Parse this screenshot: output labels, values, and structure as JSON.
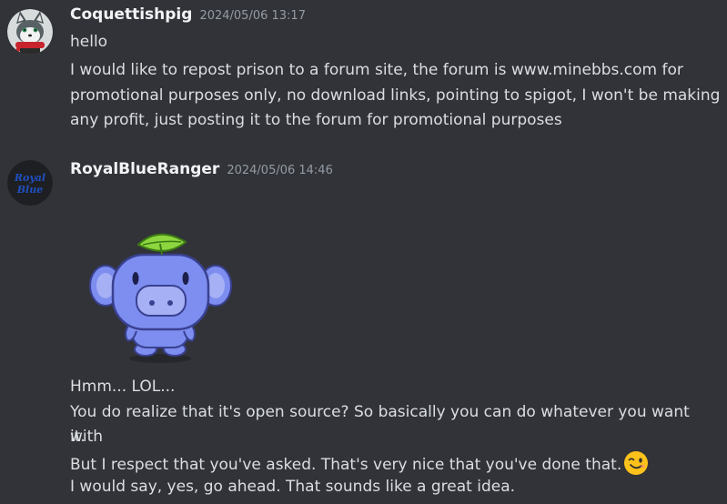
{
  "messages": [
    {
      "username": "Coquettishpig",
      "timestamp": "2024/05/06 13:17",
      "lines": [
        "hello",
        "I would like to repost prison to a forum site, the forum is www.minebbs.com for",
        "promotional purposes only, no download links, pointing to spigot, I won't be making",
        "any profit, just posting it to the forum for promotional purposes"
      ]
    },
    {
      "username": "RoyalBlueRanger",
      "timestamp": "2024/05/06 14:46",
      "avatar_text": [
        "Royal",
        "Blue"
      ],
      "lines": [
        "Hmm... LOL...",
        "You do realize that it's open source?  So basically you can do whatever you want with",
        "it.",
        "But I respect that you've asked.  That's very nice that you've done that.",
        "I would say, yes, go ahead.  That sounds like a great idea."
      ]
    }
  ],
  "colors": {
    "background": "#313338",
    "username": "#f2f3f5",
    "timestamp": "#949ba4",
    "text": "#dbdee1"
  },
  "icons": {
    "sticker": "wumpus-sticker",
    "emoji": "winking-face-emoji"
  }
}
